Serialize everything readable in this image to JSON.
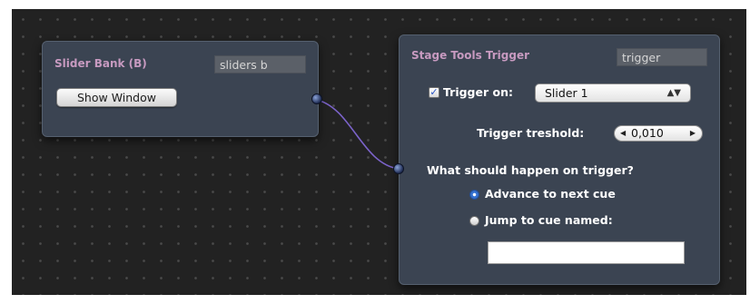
{
  "slider_bank": {
    "title": "Slider Bank (B)",
    "name_value": "sliders b",
    "show_window_label": "Show Window"
  },
  "trigger_node": {
    "title": "Stage Tools Trigger",
    "name_value": "trigger",
    "trigger_on_label": "Trigger on:",
    "trigger_on_checked": true,
    "trigger_source": "Slider 1",
    "threshold_label": "Trigger treshold:",
    "threshold_value": "0,010",
    "question": "What should happen on trigger?",
    "options": [
      {
        "label": "Advance to next cue",
        "selected": true
      },
      {
        "label": "Jump to cue named:",
        "selected": false
      }
    ],
    "cue_name_value": ""
  },
  "colors": {
    "canvas": "#222222",
    "node": "#3b4452",
    "title": "#c79ac0",
    "connection": "#7b63c9"
  }
}
